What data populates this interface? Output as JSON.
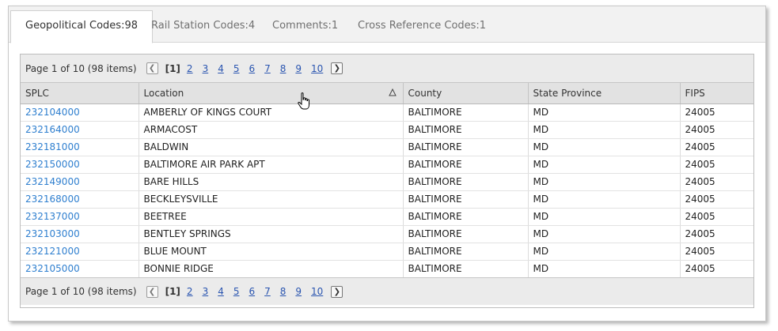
{
  "tabs": [
    {
      "label": "Geopolitical Codes:98",
      "active": true
    },
    {
      "label": "Rail Station Codes:4",
      "active": false
    },
    {
      "label": "Comments:1",
      "active": false
    },
    {
      "label": "Cross Reference Codes:1",
      "active": false
    }
  ],
  "pager": {
    "info": "Page 1 of 10 (98 items)",
    "current": "[1]",
    "pages": [
      "2",
      "3",
      "4",
      "5",
      "6",
      "7",
      "8",
      "9",
      "10"
    ],
    "prev_icon": "chevron-left-icon",
    "next_icon": "chevron-right-icon"
  },
  "table": {
    "columns": [
      "SPLC",
      "Location",
      "County",
      "State Province",
      "FIPS"
    ],
    "sort_icon": "sort-ascending-icon",
    "rows": [
      [
        "232104000",
        "AMBERLY OF KINGS COURT",
        "BALTIMORE",
        "MD",
        "24005"
      ],
      [
        "232164000",
        "ARMACOST",
        "BALTIMORE",
        "MD",
        "24005"
      ],
      [
        "232181000",
        "BALDWIN",
        "BALTIMORE",
        "MD",
        "24005"
      ],
      [
        "232150000",
        "BALTIMORE AIR PARK APT",
        "BALTIMORE",
        "MD",
        "24005"
      ],
      [
        "232149000",
        "BARE HILLS",
        "BALTIMORE",
        "MD",
        "24005"
      ],
      [
        "232168000",
        "BECKLEYSVILLE",
        "BALTIMORE",
        "MD",
        "24005"
      ],
      [
        "232137000",
        "BEETREE",
        "BALTIMORE",
        "MD",
        "24005"
      ],
      [
        "232103000",
        "BENTLEY SPRINGS",
        "BALTIMORE",
        "MD",
        "24005"
      ],
      [
        "232121000",
        "BLUE MOUNT",
        "BALTIMORE",
        "MD",
        "24005"
      ],
      [
        "232105000",
        "BONNIE RIDGE",
        "BALTIMORE",
        "MD",
        "24005"
      ]
    ]
  },
  "colors": {
    "link": "#2f7fcf",
    "pager_link": "#2a55b0"
  }
}
